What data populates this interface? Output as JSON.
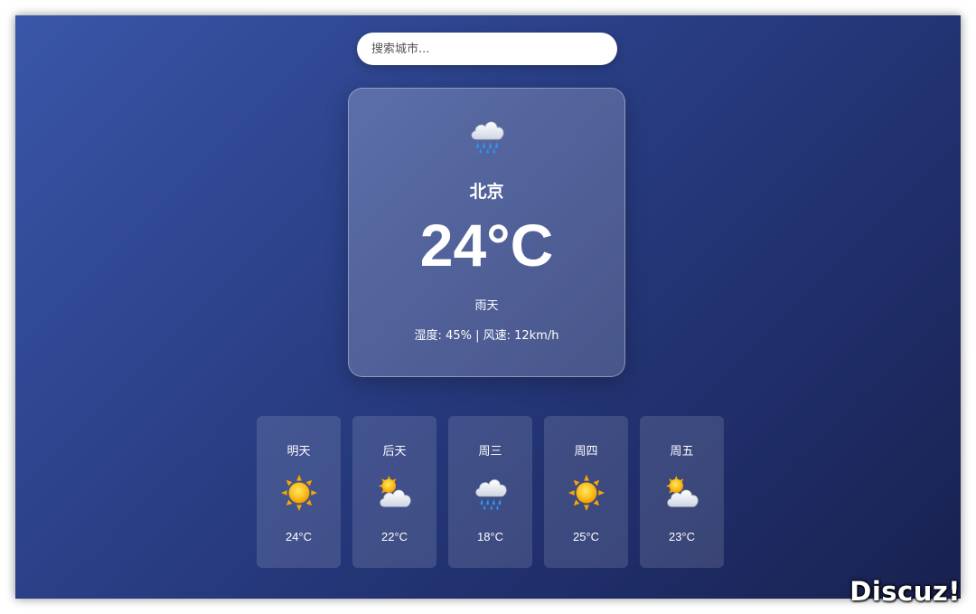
{
  "search": {
    "placeholder": "搜索城市..."
  },
  "current": {
    "icon": "rain-cloud-icon",
    "city": "北京",
    "temperature": "24°C",
    "condition": "雨天",
    "details": "湿度: 45% | 风速: 12km/h"
  },
  "forecast": [
    {
      "day": "明天",
      "icon": "sun-icon",
      "temp": "24°C"
    },
    {
      "day": "后天",
      "icon": "sun-behind-cloud-icon",
      "temp": "22°C"
    },
    {
      "day": "周三",
      "icon": "rain-cloud-icon",
      "temp": "18°C"
    },
    {
      "day": "周四",
      "icon": "sun-icon",
      "temp": "25°C"
    },
    {
      "day": "周五",
      "icon": "sun-behind-cloud-icon",
      "temp": "23°C"
    }
  ],
  "watermark": "Discuz!",
  "colors": {
    "background_start": "#3a56a8",
    "background_end": "#18214f",
    "sun": "#f7b500",
    "rain": "#3aa0ff",
    "text": "#ffffff"
  }
}
